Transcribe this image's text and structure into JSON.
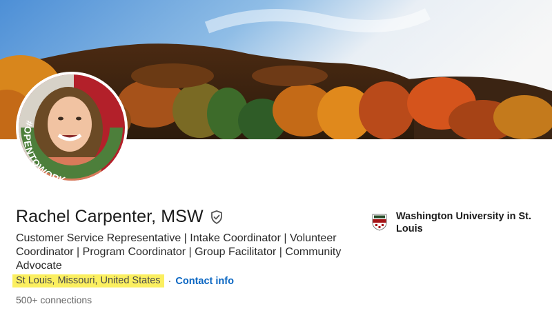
{
  "profile": {
    "name": "Rachel Carpenter, MSW",
    "headline": "Customer Service Representative | Intake Coordinator | Volunteer Coordinator | Program Coordinator | Group Facilitator | Community Advocate",
    "location": "St Louis, Missouri, United States",
    "separator": "·",
    "contact_info_label": "Contact info",
    "connections": "500+ connections",
    "open_to_work_badge": "#OPENTOWORK",
    "verified_icon": "shield-check-icon"
  },
  "education": {
    "school_name": "Washington University in St. Louis"
  },
  "colors": {
    "link_blue": "#0a66c2",
    "highlight_yellow": "#fbef60",
    "open_to_work_green": "#4d7f3b",
    "school_red": "#a51417"
  }
}
